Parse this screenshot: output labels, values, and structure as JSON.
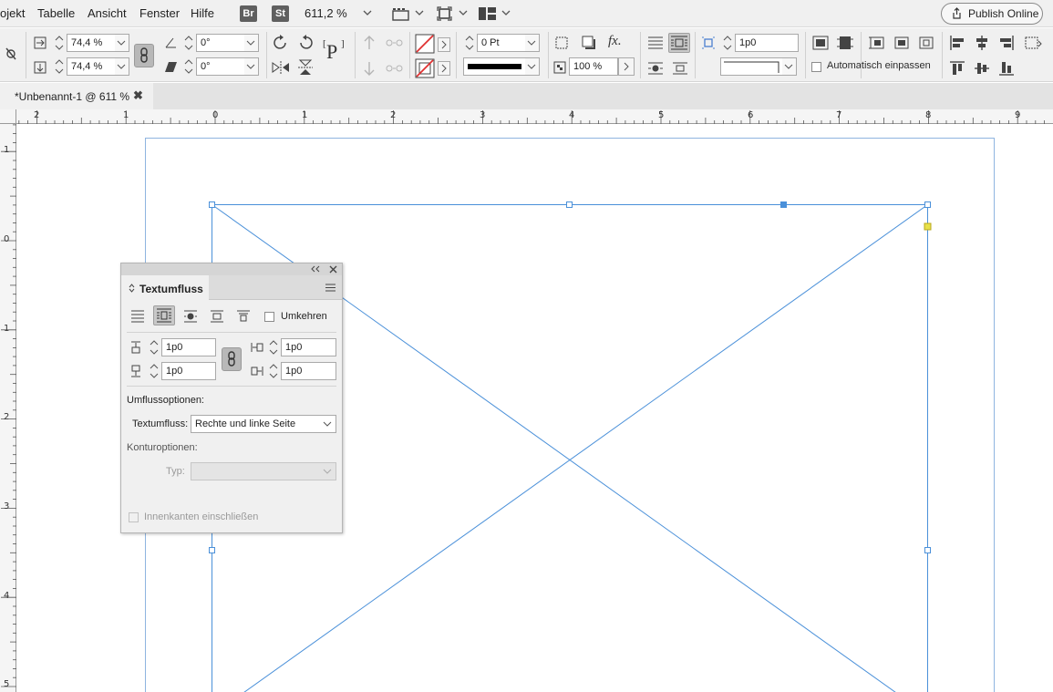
{
  "menubar": {
    "items": [
      "ojekt",
      "Tabelle",
      "Ansicht",
      "Fenster",
      "Hilfe"
    ],
    "bridge_badge": "Br",
    "stock_badge": "St",
    "zoom": "611,2 %",
    "publish_label": "Publish Online"
  },
  "control": {
    "scale_x": "74,4 %",
    "scale_y": "74,4 %",
    "rotation": "0°",
    "shear": "0°",
    "paragraph_glyph": "P",
    "stroke_weight": "0 Pt",
    "opacity": "100 %",
    "wrap_offset": "1p0",
    "fx_label": "fx.",
    "auto_fit_label": "Automatisch einpassen"
  },
  "tab": {
    "title": "*Unbenannt-1 @ 611 %",
    "close": "✖"
  },
  "ruler": {
    "h_labels": [
      "2",
      "1",
      "0",
      "1",
      "2",
      "3",
      "4",
      "5",
      "6",
      "7",
      "8",
      "9"
    ],
    "v_labels": [
      "1",
      "0",
      "1",
      "2",
      "3",
      "4",
      "5"
    ]
  },
  "wrap_panel": {
    "title": "Textumfluss",
    "invert_label": "Umkehren",
    "top_offset": "1p0",
    "bottom_offset": "1p0",
    "left_offset": "1p0",
    "right_offset": "1p0",
    "wrap_options_heading": "Umflussoptionen:",
    "wrap_to_label": "Textumfluss:",
    "wrap_to_value": "Rechte und linke Seite",
    "contour_heading": "Konturoptionen:",
    "type_label": "Typ:",
    "inside_edges_label": "Innenkanten einschließen"
  },
  "colors": {
    "selection": "#4a90d9",
    "handle_yellow": "#e7e14a"
  }
}
